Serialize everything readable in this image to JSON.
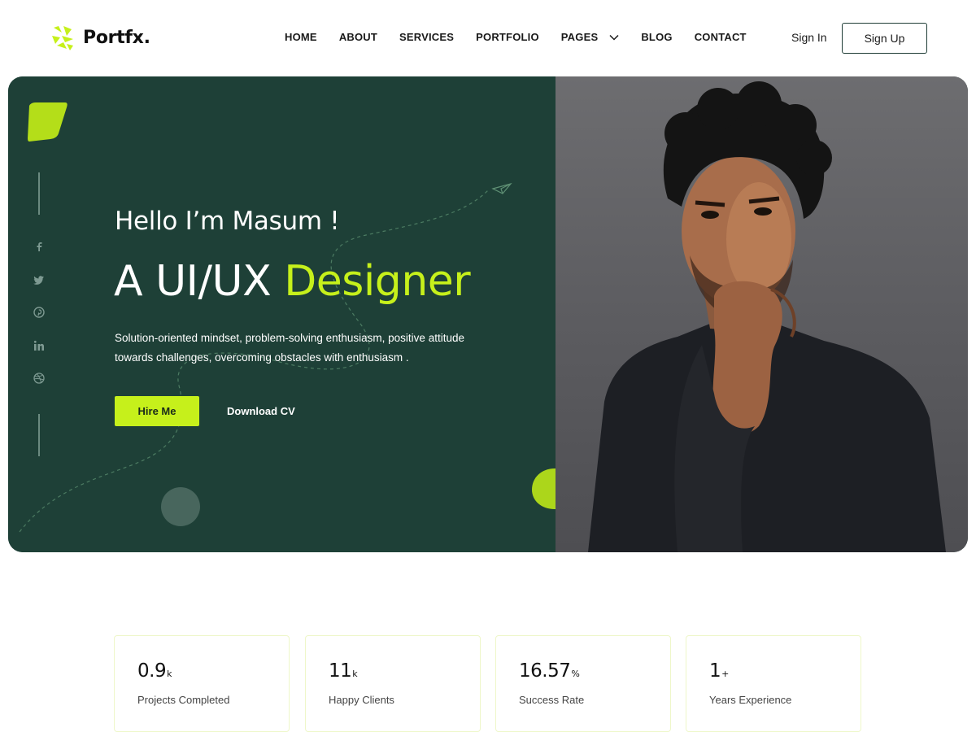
{
  "brand": {
    "name": "Portfx.",
    "accent": "#c6f01b",
    "dark": "#1e4037"
  },
  "nav": {
    "items": [
      {
        "label": "HOME",
        "active": true
      },
      {
        "label": "ABOUT"
      },
      {
        "label": "SERVICES"
      },
      {
        "label": "PORTFOLIO"
      },
      {
        "label": "PAGES",
        "dropdown": true
      },
      {
        "label": "BLOG"
      },
      {
        "label": "CONTACT"
      }
    ],
    "sign_in": "Sign In",
    "sign_up": "Sign Up"
  },
  "hero": {
    "greeting": "Hello I’m Masum !",
    "title_plain": "A UI/UX ",
    "title_accent": "Designer",
    "description_line1": "Solution-oriented mindset, problem-solving enthusiasm, positive attitude",
    "description_line2": "towards challenges, overcoming obstacles with enthusiasm .",
    "primary_button": "Hire Me",
    "secondary_link": "Download CV",
    "social_icons": [
      "facebook-icon",
      "twitter-icon",
      "pinterest-icon",
      "linkedin-icon",
      "dribbble-icon"
    ]
  },
  "stats": [
    {
      "value": "0.9",
      "unit": "k",
      "label": "Projects Completed"
    },
    {
      "value": "11",
      "unit": "k",
      "label": "Happy Clients"
    },
    {
      "value": "16.57",
      "unit": "%",
      "label": "Success Rate"
    },
    {
      "value": "1",
      "unit": "+",
      "label": "Years Experience"
    }
  ]
}
